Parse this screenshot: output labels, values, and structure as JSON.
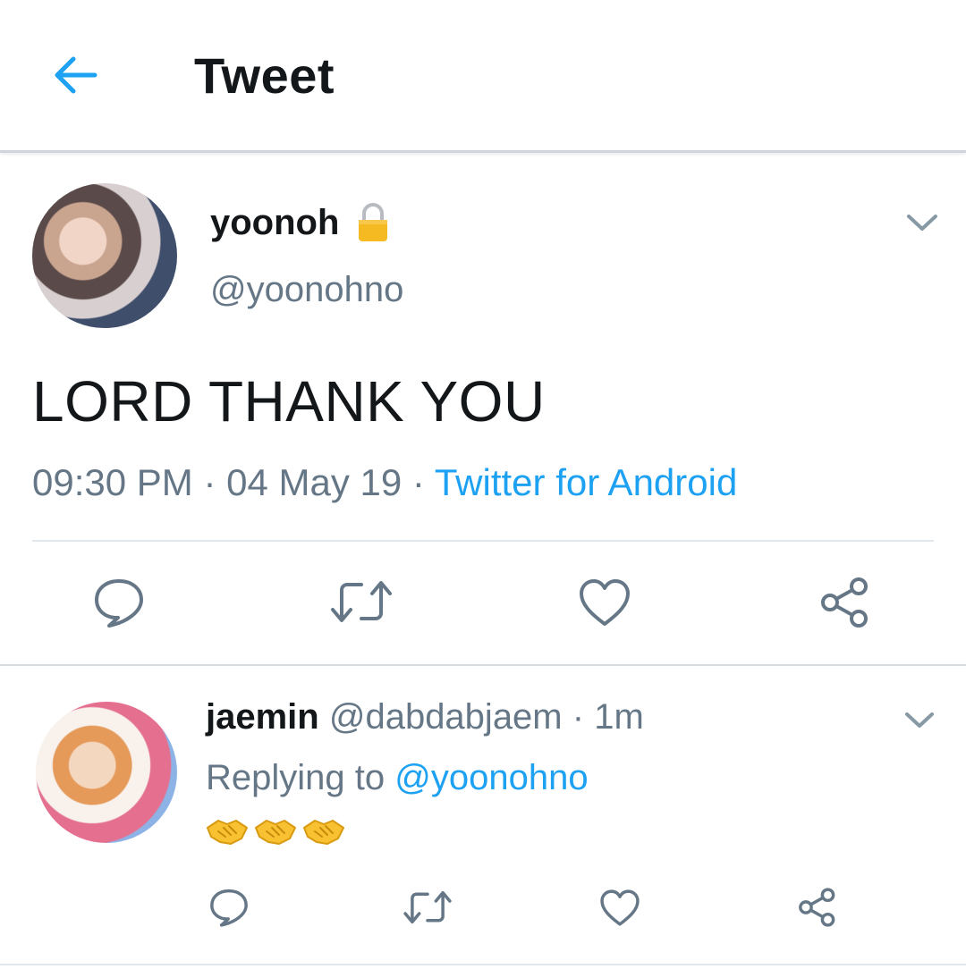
{
  "header": {
    "title": "Tweet"
  },
  "tweet": {
    "author_name": "yoonoh",
    "author_handle": "@yoonohno",
    "text": "LORD THANK YOU",
    "time": "09:30 PM",
    "date": "04 May 19",
    "source": "Twitter for Android",
    "separator": "·"
  },
  "reply": {
    "author_name": "jaemin",
    "author_handle": "@dabdabjaem",
    "age": "1m",
    "replying_prefix": "Replying to",
    "replying_to": "@yoonohno",
    "emoji": "🤝🤝🤝"
  },
  "colors": {
    "accent": "#1da1f2",
    "secondary_text": "#657786",
    "primary_text": "#14171a",
    "lock": "#f5b921"
  },
  "icons": [
    "back-arrow-icon",
    "lock-icon",
    "chevron-down-icon",
    "reply-icon",
    "retweet-icon",
    "like-icon",
    "share-icon",
    "handshake-emoji"
  ]
}
